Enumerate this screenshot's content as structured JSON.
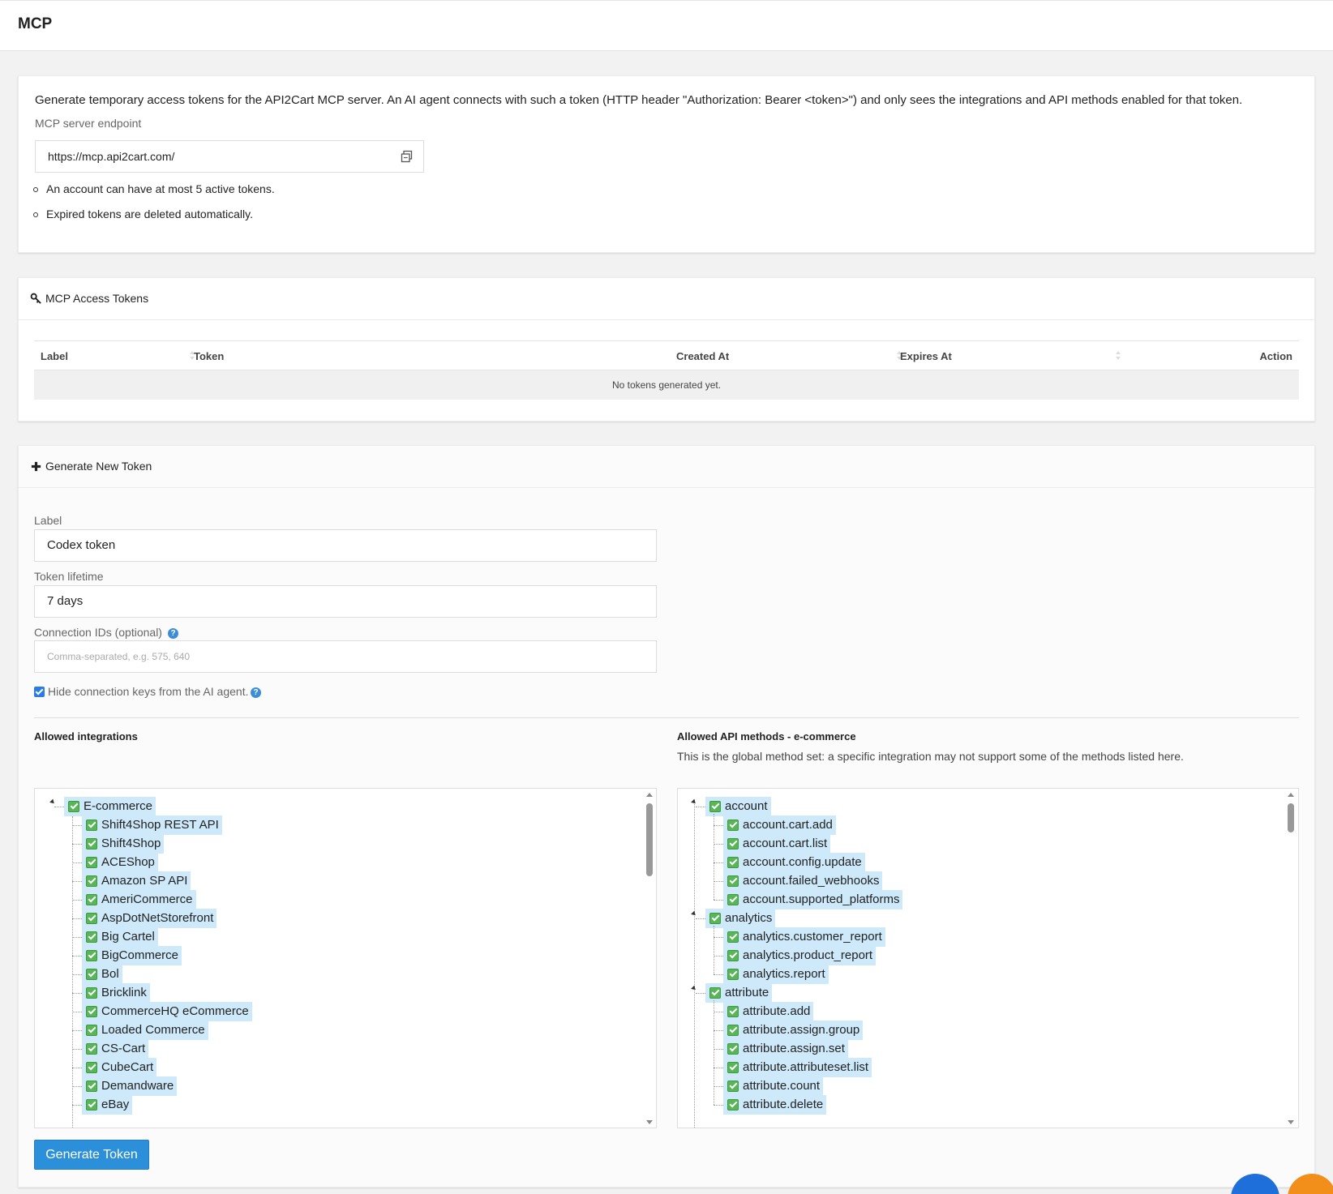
{
  "page": {
    "title": "MCP"
  },
  "intro": {
    "description": "Generate temporary access tokens for the API2Cart MCP server. An AI agent connects with such a token (HTTP header \"Authorization: Bearer <token>\") and only sees the integrations and API methods enabled for that token.",
    "endpoint_label": "MCP server endpoint",
    "endpoint_value": "https://mcp.api2cart.com/",
    "notes": [
      "An account can have at most 5 active tokens.",
      "Expired tokens are deleted automatically."
    ]
  },
  "tokens": {
    "title": "MCP Access Tokens",
    "columns": [
      "Label",
      "Token",
      "Created At",
      "Expires At",
      "Action"
    ],
    "empty_text": "No tokens generated yet."
  },
  "generate": {
    "title": "Generate New Token",
    "label_label": "Label",
    "label_value": "Codex token",
    "lifetime_label": "Token lifetime",
    "lifetime_value": "7 days",
    "connection_label": "Connection IDs (optional)",
    "connection_placeholder": "Comma-separated, e.g. 575, 640",
    "hide_keys_label": "Hide connection keys from the AI agent.",
    "hide_keys_checked": true,
    "integrations_title": "Allowed integrations",
    "methods_title": "Allowed API methods - e-commerce",
    "methods_note": "This is the global method set: a specific integration may not support some of the methods listed here.",
    "integrations_root": "E-commerce",
    "integrations": [
      "Shift4Shop REST API",
      "Shift4Shop",
      "ACEShop",
      "Amazon SP API",
      "AmeriCommerce",
      "AspDotNetStorefront",
      "Big Cartel",
      "BigCommerce",
      "Bol",
      "Bricklink",
      "CommerceHQ eCommerce",
      "Loaded Commerce",
      "CS-Cart",
      "CubeCart",
      "Demandware",
      "eBay"
    ],
    "methods": [
      {
        "group": "account",
        "items": [
          "account.cart.add",
          "account.cart.list",
          "account.config.update",
          "account.failed_webhooks",
          "account.supported_platforms"
        ]
      },
      {
        "group": "analytics",
        "items": [
          "analytics.customer_report",
          "analytics.product_report",
          "analytics.report"
        ]
      },
      {
        "group": "attribute",
        "items": [
          "attribute.add",
          "attribute.assign.group",
          "attribute.assign.set",
          "attribute.attributeset.list",
          "attribute.count",
          "attribute.delete"
        ]
      }
    ],
    "submit_label": "Generate Token"
  },
  "colors": {
    "primary": "#2b90d9",
    "highlight": "#cde9fa",
    "check": "#58b658",
    "fab_blue": "#1e6fd9",
    "fab_orange": "#f28f1b"
  }
}
